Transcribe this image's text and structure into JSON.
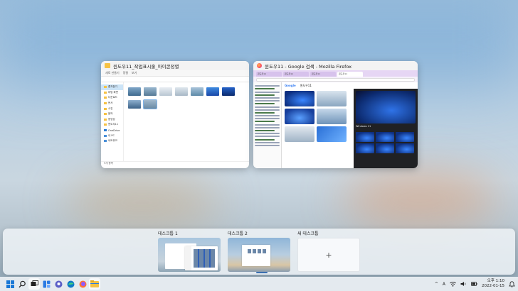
{
  "windows": {
    "explorer": {
      "title": "윈도우11_작업표시줄_아이콘정렬",
      "toolbar": [
        "새로 만들기",
        "정렬",
        "보기"
      ],
      "nav_items": [
        "즐겨찾기",
        "바탕 화면",
        "다운로드",
        "문서",
        "사진",
        "음악",
        "동영상",
        "윈도우11",
        "OneDrive",
        "내 PC",
        "네트워크"
      ],
      "status": "9개 항목"
    },
    "firefox": {
      "title": "윈도우11 - Google 검색 - Mozilla Firefox",
      "tabs": [
        "윈도우11",
        "윈도우11",
        "윈도우11",
        "윈도우11"
      ],
      "google_logo": "Google",
      "search_term": "윈도우11",
      "panel_caption": "Windows 11"
    }
  },
  "desktops": {
    "items": [
      {
        "label": "데스크톱 1"
      },
      {
        "label": "데스크톱 2"
      },
      {
        "label": "새 데스크톱"
      }
    ],
    "add_symbol": "+"
  },
  "taskbar": {
    "apps": [
      "start-icon",
      "search-icon",
      "task-view-icon",
      "widgets-icon",
      "chat-icon",
      "edge-icon",
      "firefox-icon",
      "file-explorer-icon"
    ],
    "tray": {
      "ime": "A",
      "chevron": "^",
      "time": "오후 1:10",
      "date": "2022-01-15"
    }
  }
}
